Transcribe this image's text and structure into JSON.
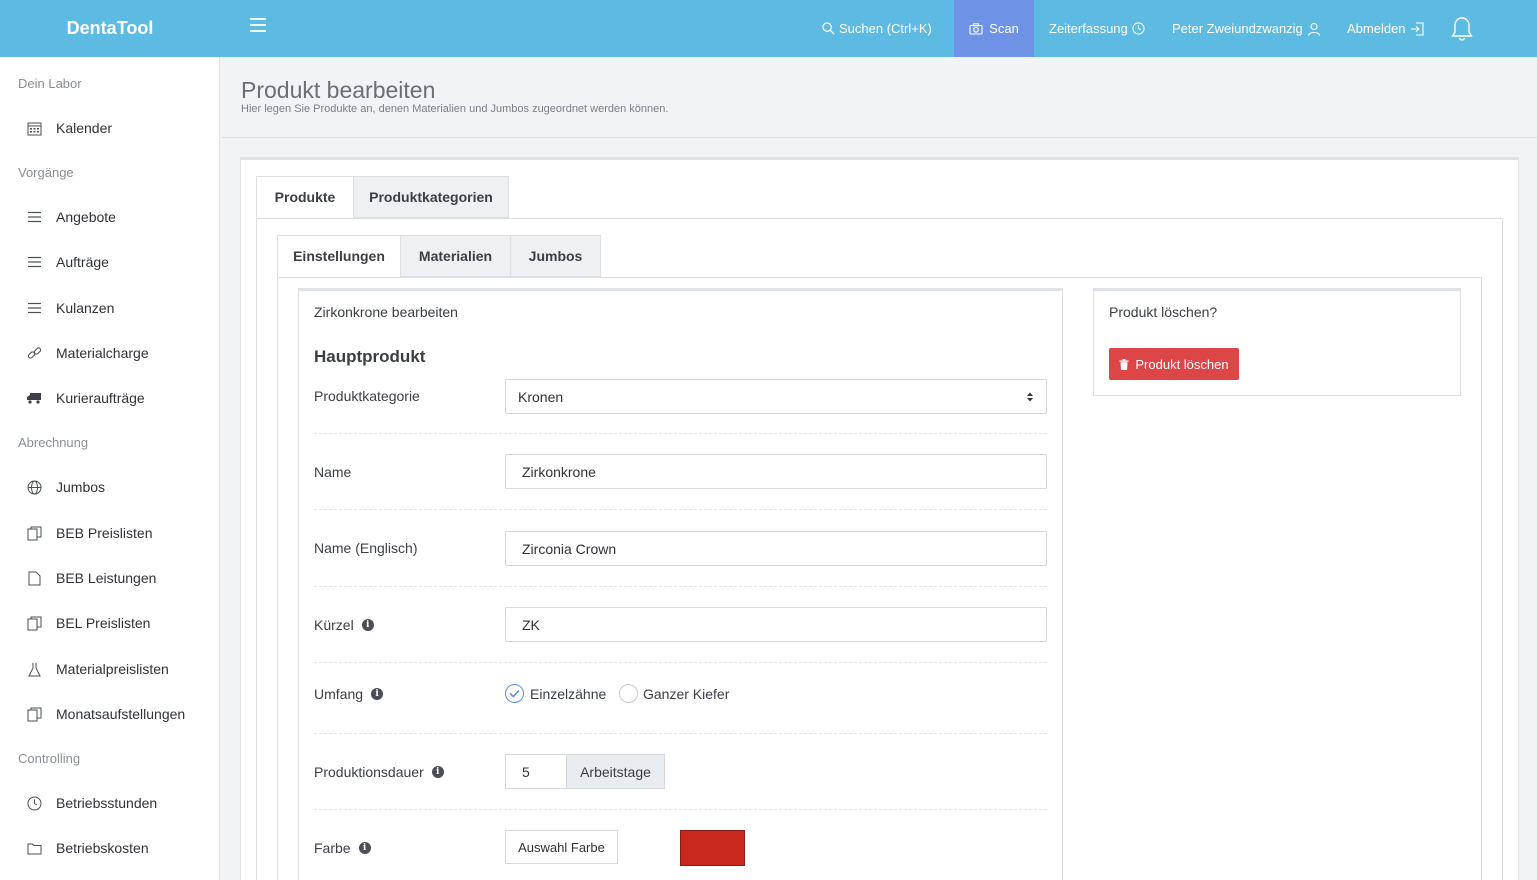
{
  "app": {
    "brand": "DentaTool"
  },
  "topnav": {
    "search": "Suchen (Ctrl+K)",
    "scan": "Scan",
    "time": "Zeiterfassung",
    "user": "Peter Zweiundzwanzig",
    "logout": "Abmelden"
  },
  "sidebar": {
    "sections": [
      "Dein Labor",
      "Vorgänge",
      "Abrechnung",
      "Controlling"
    ],
    "items": [
      {
        "label": "Kalender",
        "icon": "calendar-icon"
      },
      {
        "label": "Angebote",
        "icon": "list-icon"
      },
      {
        "label": "Aufträge",
        "icon": "list-icon"
      },
      {
        "label": "Kulanzen",
        "icon": "list-icon"
      },
      {
        "label": "Materialcharge",
        "icon": "link-icon"
      },
      {
        "label": "Kurieraufträge",
        "icon": "truck-icon"
      },
      {
        "label": "Jumbos",
        "icon": "globe-icon"
      },
      {
        "label": "BEB Preislisten",
        "icon": "documents-icon"
      },
      {
        "label": "BEB Leistungen",
        "icon": "document-icon"
      },
      {
        "label": "BEL Preislisten",
        "icon": "documents-icon"
      },
      {
        "label": "Materialpreislisten",
        "icon": "flask-icon"
      },
      {
        "label": "Monatsaufstellungen",
        "icon": "documents-icon"
      },
      {
        "label": "Betriebsstunden",
        "icon": "clock-icon"
      },
      {
        "label": "Betriebskosten",
        "icon": "folder-icon"
      }
    ]
  },
  "page": {
    "title": "Produkt bearbeiten",
    "subtitle": "Hier legen Sie Produkte an, denen Materialien und Jumbos zugeordnet werden können."
  },
  "tabs": {
    "outer": [
      "Produkte",
      "Produktkategorien"
    ],
    "inner": [
      "Einstellungen",
      "Materialien",
      "Jumbos"
    ]
  },
  "form": {
    "box_title": "Zirkonkrone bearbeiten",
    "section": "Hauptprodukt",
    "category_label": "Produktkategorie",
    "category_value": "Kronen",
    "name_label": "Name",
    "name_value": "Zirkonkrone",
    "name_en_label": "Name (Englisch)",
    "name_en_value": "Zirconia Crown",
    "short_label": "Kürzel",
    "short_value": "ZK",
    "scope_label": "Umfang",
    "scope_options": [
      "Einzelzähne",
      "Ganzer Kiefer"
    ],
    "scope_selected": "Einzelzähne",
    "duration_label": "Produktionsdauer",
    "duration_value": "5",
    "duration_unit": "Arbeitstage",
    "color_label": "Farbe",
    "color_button": "Auswahl Farbe",
    "color_value": "#c8281e"
  },
  "delete": {
    "title": "Produkt löschen?",
    "button": "Produkt löschen",
    "button_color": "#dc4646"
  },
  "colors": {
    "topbar": "#5dbbe3",
    "scan_active": "#6d92e6",
    "radio_check": "#5b8fd9"
  }
}
